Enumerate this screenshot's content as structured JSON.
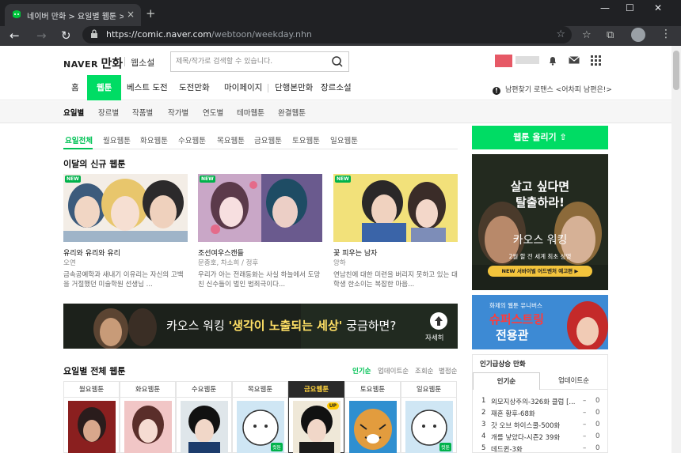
{
  "browser": {
    "tab_title": "네이버 만화 > 요일별 웹툰 > 전체",
    "tab_close": "×",
    "new_tab": "+",
    "url_host": "https://comic.naver.com",
    "url_path": "/webtoon/weekday.nhn",
    "minimize": "—",
    "maximize": "☐",
    "close": "✕",
    "back": "←",
    "forward": "→",
    "reload": "↻",
    "menu": "⋮",
    "accent": "#202124"
  },
  "header": {
    "logo_naver": "NAVER",
    "logo_manhwa": "만화",
    "webnovel": "웹소설",
    "search_placeholder": "제목/작가로 검색할 수 있습니다."
  },
  "gnb": {
    "items": [
      "홈",
      "웹툰",
      "베스트 도전",
      "도전만화",
      "마이페이지",
      "단행본만화",
      "장르소설"
    ],
    "active": "웹툰",
    "notice": "남편찾기 로맨스 <어차피 남편은!>",
    "notice_icon": "!"
  },
  "lnb": {
    "items": [
      "요일별",
      "장르별",
      "작품별",
      "작가별",
      "연도별",
      "테마웹툰",
      "완결웹툰"
    ],
    "active": "요일별"
  },
  "day_tabs": {
    "items": [
      "요일전체",
      "월요웹툰",
      "화요웹툰",
      "수요웹툰",
      "목요웹툰",
      "금요웹툰",
      "토요웹툰",
      "일요웹툰"
    ],
    "active": "요일전체"
  },
  "new_section": {
    "title": "이달의 신규 웹툰",
    "badge": "NEW",
    "cards": [
      {
        "title": "유리와 유리와 유리",
        "author": "오연",
        "desc": "금속공예학과 새내기 이유리는 자신의 고백을 거절했던 미술학원 선생님 ..."
      },
      {
        "title": "조선여우스캔들",
        "author": "문종호, 차소희 / 정후",
        "desc": "우리가 아는 전래동화는 사실 하늘에서 도망친 신수들이 벌인 범죄극이다..."
      },
      {
        "title": "꽃 피우는 남자",
        "author": "앙하",
        "desc": "연남친에 대한 미련을 버리지 못하고 있는 대학생 한소이는 복잡한 마음..."
      }
    ]
  },
  "banner": {
    "text_a": "카오스 워킹 ",
    "text_b": "'생각이 노출되는 세상'",
    "text_c": " 궁금하면?",
    "more": "자세히"
  },
  "weekly_section": {
    "title": "요일별 전체 웹툰",
    "sort": [
      "인기순",
      "업데이트순",
      "조회순",
      "별점순"
    ],
    "sort_active": "인기순",
    "days": [
      "월요웹툰",
      "화요웹툰",
      "수요웹툰",
      "목요웹툰",
      "금요웹툰",
      "토요웹툰",
      "일요웹툰"
    ],
    "active_day": "금요웹툰",
    "up_badge": "UP",
    "cut_badge": "컷툰"
  },
  "sidebar": {
    "upload_button": "웹툰 올리기",
    "upload_icon": "⇧",
    "ad1": {
      "line1": "살고 싶다면",
      "line2": "탈출하라!",
      "title": "카오스 워킹",
      "sub": "2월 할 전 세계 최초 상영",
      "cta": "NEW 서바이벌 어드벤처 예고편 ▶"
    },
    "ad2": {
      "line1": "화제의 웹툰 유니버스",
      "line2": "슈퍼스트링",
      "line3": "전용관"
    },
    "ranking": {
      "title": "인기급상승 만화",
      "tabs": [
        "인기순",
        "업데이트순"
      ],
      "active_tab": "인기순",
      "rows": [
        {
          "rank": "1",
          "name": "외모지상주의-326화 클럽 [...",
          "change": "–",
          "value": "0"
        },
        {
          "rank": "2",
          "name": "재혼 황후-68화",
          "change": "–",
          "value": "0"
        },
        {
          "rank": "3",
          "name": "갓 오브 하이스쿨-500화",
          "change": "–",
          "value": "0"
        },
        {
          "rank": "4",
          "name": "개를 낳았다-시즌2 39화",
          "change": "–",
          "value": "0"
        },
        {
          "rank": "5",
          "name": "데드퀸-3화",
          "change": "–",
          "value": "0"
        }
      ]
    }
  },
  "colors": {
    "brand_green": "#00dc64",
    "active_green": "#00c255"
  }
}
